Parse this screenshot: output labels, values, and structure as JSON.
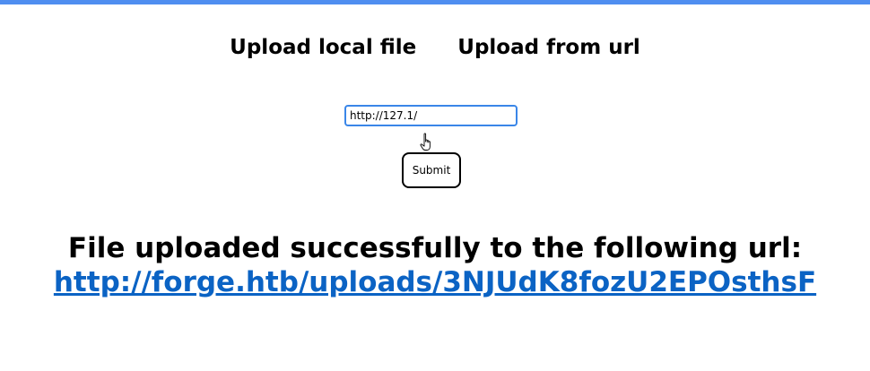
{
  "tabs": {
    "upload_local": "Upload local file",
    "upload_url": "Upload from url"
  },
  "form": {
    "url_value": "http://127.1/",
    "submit_label": "Submit"
  },
  "result": {
    "message": "File uploaded successfully to the following url:",
    "link_text": "http://forge.htb/uploads/3NJUdK8fozU2EPOsthsF"
  },
  "colors": {
    "top_bar": "#4f8ef0",
    "input_focus_border": "#3a86e8",
    "link": "#0b63c4"
  },
  "icons": {
    "pointer": "hand-pointer-icon"
  }
}
